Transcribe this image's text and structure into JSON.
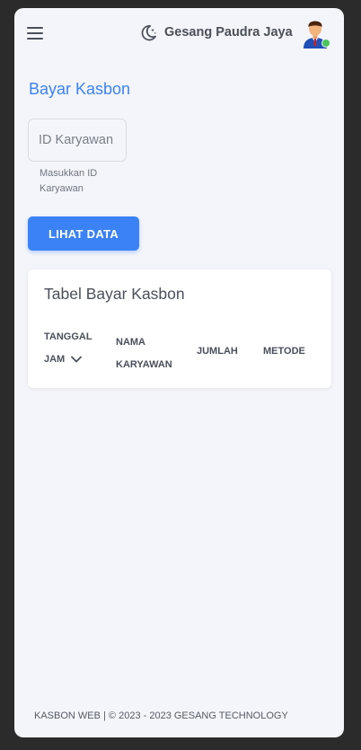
{
  "header": {
    "menu_icon": "hamburger-menu-icon",
    "theme_icon": "moon-stars-icon",
    "user_name": "Gesang Paudra Jaya",
    "avatar_icon": "user-avatar-icon",
    "status": "online"
  },
  "main": {
    "title": "Bayar Kasbon",
    "id_input": {
      "placeholder": "ID Karyawan",
      "value": ""
    },
    "helper_text": "Masukkan ID Karyawan",
    "view_button": "LIHAT DATA"
  },
  "table": {
    "title": "Tabel Bayar Kasbon",
    "columns": [
      "TANGGAL JAM",
      "NAMA KARYAWAN",
      "JUMLAH",
      "METODE"
    ],
    "sort_icon": "chevron-down-icon",
    "rows": []
  },
  "footer": {
    "text": "KASBON WEB | © 2023 - 2023 GESANG TECHNOLOGY"
  },
  "colors": {
    "accent": "#3b82f6",
    "background": "#f4f5fa",
    "status_online": "#49c55a"
  }
}
